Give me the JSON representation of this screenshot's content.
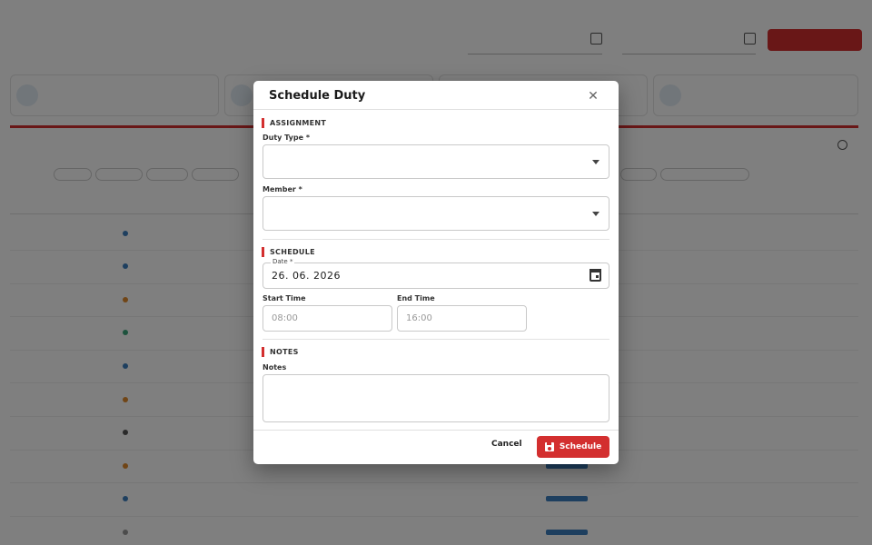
{
  "modal": {
    "title": "Schedule Duty",
    "close_glyph": "✕",
    "sections": {
      "assignment": "ASSIGNMENT",
      "schedule": "SCHEDULE",
      "notes": "NOTES"
    },
    "duty_type": {
      "label": "Duty Type *",
      "value": ""
    },
    "member": {
      "label": "Member *",
      "value": ""
    },
    "date": {
      "label": "Date *",
      "value": "26. 06. 2026"
    },
    "start_time": {
      "label": "Start Time",
      "placeholder": "08:00"
    },
    "end_time": {
      "label": "End Time",
      "placeholder": "16:00"
    },
    "notes": {
      "label": "Notes",
      "value": ""
    },
    "cancel_label": "Cancel",
    "schedule_label": "Schedule"
  },
  "colors": {
    "accent": "#d32f2f",
    "overlay": "rgba(0,0,0,0.5)"
  }
}
